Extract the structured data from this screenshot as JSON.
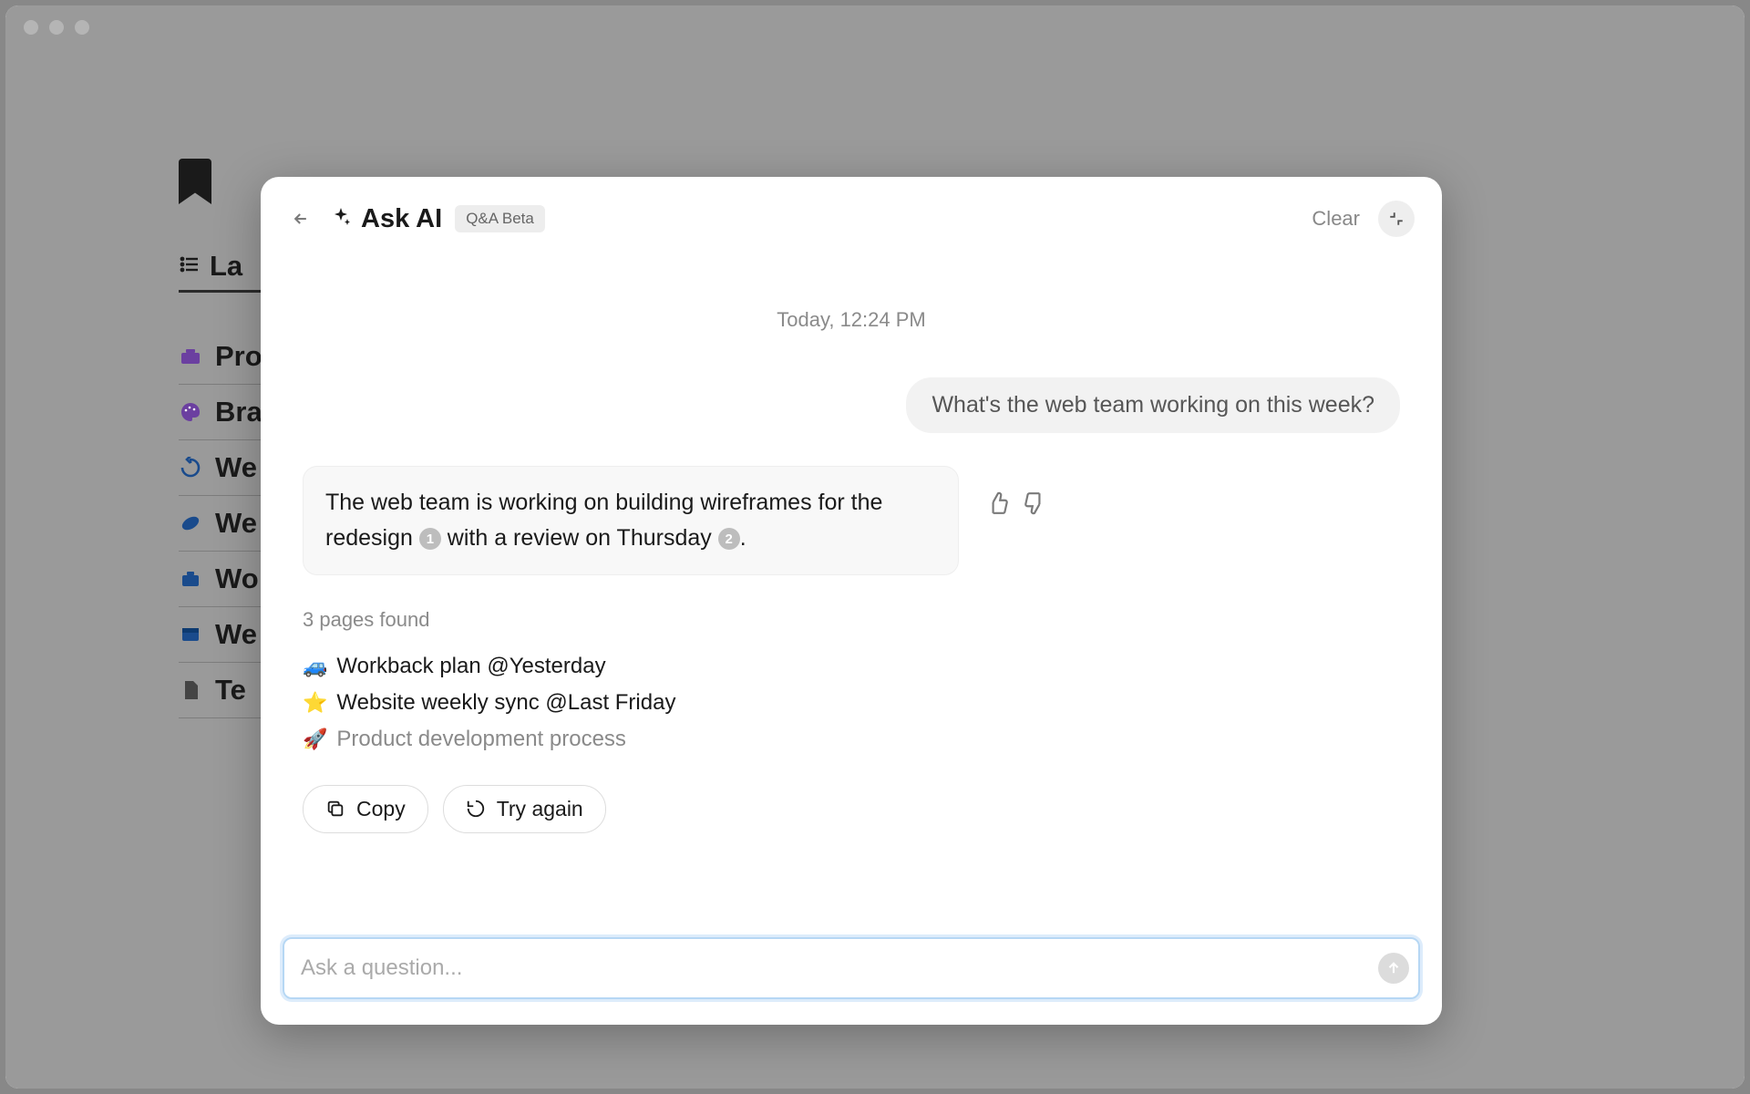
{
  "modal": {
    "title": "Ask AI",
    "badge": "Q&A Beta",
    "clear_label": "Clear",
    "timestamp": "Today, 12:24 PM",
    "user_question": "What's the web team working on this week?",
    "ai_answer_part1": "The web team is working on building wireframes for the redesign ",
    "ai_answer_ref1": "1",
    "ai_answer_part2": " with a review on Thursday ",
    "ai_answer_ref2": "2",
    "ai_answer_part3": ".",
    "pages_found_label": "3 pages found",
    "sources": [
      {
        "emoji": "🚙",
        "title": "Workback plan @Yesterday"
      },
      {
        "emoji": "⭐",
        "title": "Website weekly sync @Last Friday"
      },
      {
        "emoji": "🚀",
        "title": "Product development process"
      }
    ],
    "copy_label": "Copy",
    "try_again_label": "Try again",
    "input_placeholder": "Ask a question..."
  },
  "background": {
    "tab_label": "La",
    "list": [
      {
        "label": "Pro"
      },
      {
        "label": "Bra"
      },
      {
        "label": "We"
      },
      {
        "label": "We"
      },
      {
        "label": "Wo"
      },
      {
        "label": "We"
      },
      {
        "label": "Te"
      }
    ]
  }
}
